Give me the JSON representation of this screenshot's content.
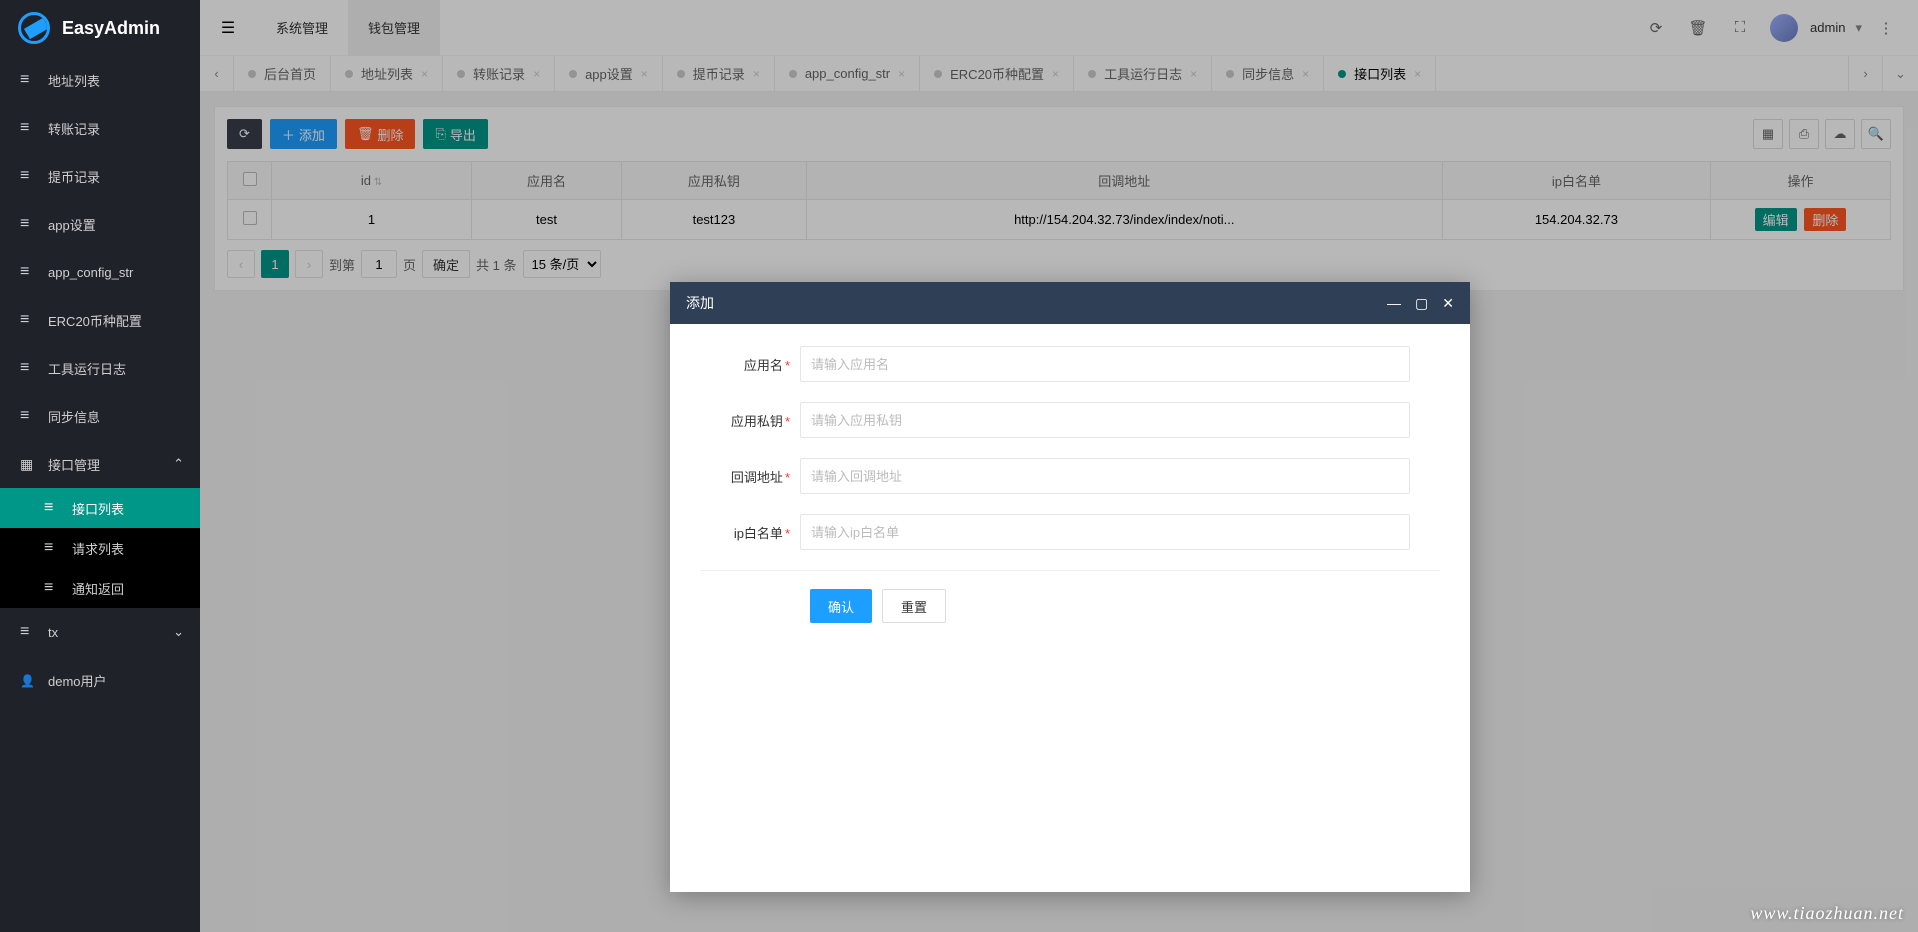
{
  "brand": "EasyAdmin",
  "topnav": {
    "sys": "系统管理",
    "wallet": "钱包管理"
  },
  "headerUser": "admin",
  "sidebar": {
    "addr": "地址列表",
    "transfer": "转账记录",
    "withdraw": "提币记录",
    "appset": "app设置",
    "appcfg": "app_config_str",
    "erc20": "ERC20币种配置",
    "toollog": "工具运行日志",
    "sync": "同步信息",
    "api": "接口管理",
    "api_list": "接口列表",
    "api_req": "请求列表",
    "api_notify": "通知返回",
    "tx": "tx",
    "demo": "demo用户"
  },
  "tabs": {
    "home": "后台首页",
    "addr": "地址列表",
    "transfer": "转账记录",
    "appset": "app设置",
    "withdraw": "提币记录",
    "appcfg": "app_config_str",
    "erc20": "ERC20币种配置",
    "toollog": "工具运行日志",
    "sync": "同步信息",
    "apilist": "接口列表"
  },
  "toolbar": {
    "add": "添加",
    "delete": "删除",
    "export": "导出"
  },
  "table": {
    "cols": {
      "id": "id",
      "name": "应用名",
      "secret": "应用私钥",
      "callback": "回调地址",
      "ipwhite": "ip白名单",
      "ops": "操作"
    },
    "row": {
      "id": "1",
      "name": "test",
      "secret": "test123",
      "callback": "http://154.204.32.73/index/index/noti...",
      "ipwhite": "154.204.32.73"
    },
    "edit": "编辑",
    "del": "删除"
  },
  "pager": {
    "page": "1",
    "goto_l": "到第",
    "goto_v": "1",
    "goto_r": "页",
    "confirm": "确定",
    "total": "共 1 条",
    "size": "15 条/页"
  },
  "modal": {
    "title": "添加",
    "fields": {
      "name": {
        "label": "应用名",
        "ph": "请输入应用名"
      },
      "secret": {
        "label": "应用私钥",
        "ph": "请输入应用私钥"
      },
      "callback": {
        "label": "回调地址",
        "ph": "请输入回调地址"
      },
      "ipwhite": {
        "label": "ip白名单",
        "ph": "请输入ip白名单"
      }
    },
    "confirm": "确认",
    "reset": "重置"
  },
  "watermark": "www.tiaozhuan.net"
}
